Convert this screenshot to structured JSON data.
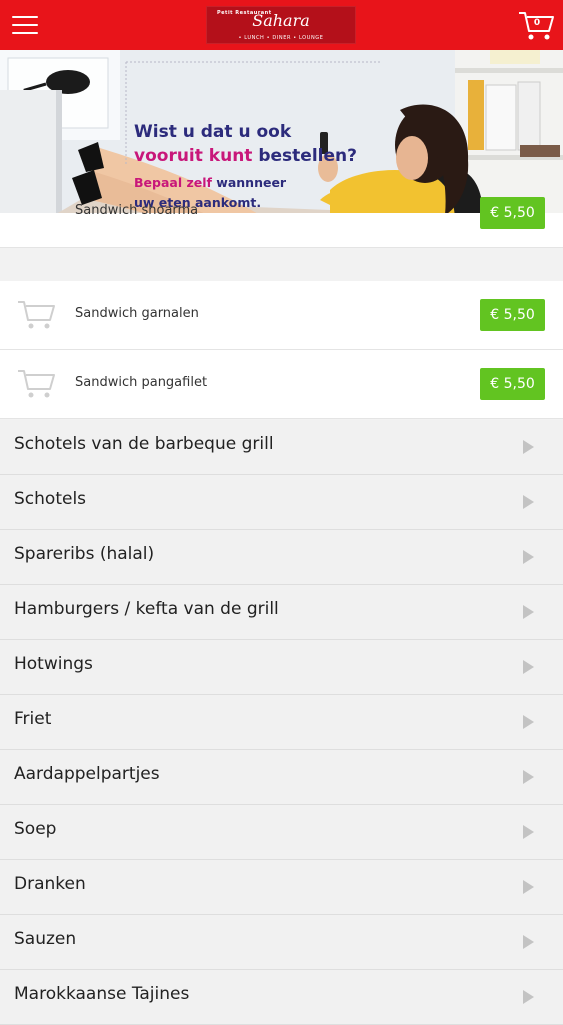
{
  "header": {
    "logo": {
      "small_text": "Petit Restaurant",
      "name": "Sahara",
      "tagline": "• LUNCH  • DINER  • LOUNGE"
    },
    "cart_count": "0",
    "menu_icon": "hamburger-menu-icon",
    "cart_icon": "shopping-cart-icon",
    "colors": {
      "bar": "#e8141a"
    }
  },
  "banner": {
    "line1": "Wist u dat u ook",
    "line2_a": "vooruit kunt",
    "line2_b": "bestellen?",
    "line3_a": "Bepaal zelf",
    "line3_b": "wannneer",
    "line4": "uw eten aankomt."
  },
  "items": [
    {
      "name": "Sandwich shoarma",
      "price": "€ 5,50"
    },
    {
      "name": "Sandwich garnalen",
      "price": "€ 5,50"
    },
    {
      "name": "Sandwich pangafilet",
      "price": "€ 5,50"
    }
  ],
  "categories": [
    "Schotels van de barbeque grill",
    "Schotels",
    "Spareribs (halal)",
    "Hamburgers / kefta van de grill",
    "Hotwings",
    "Friet",
    "Aardappelpartjes",
    "Soep",
    "Dranken",
    "Sauzen",
    "Marokkaanse Tajines"
  ],
  "colors": {
    "price_bg": "#62c421",
    "accent": "#c8177a",
    "navy": "#2c2b7c"
  }
}
